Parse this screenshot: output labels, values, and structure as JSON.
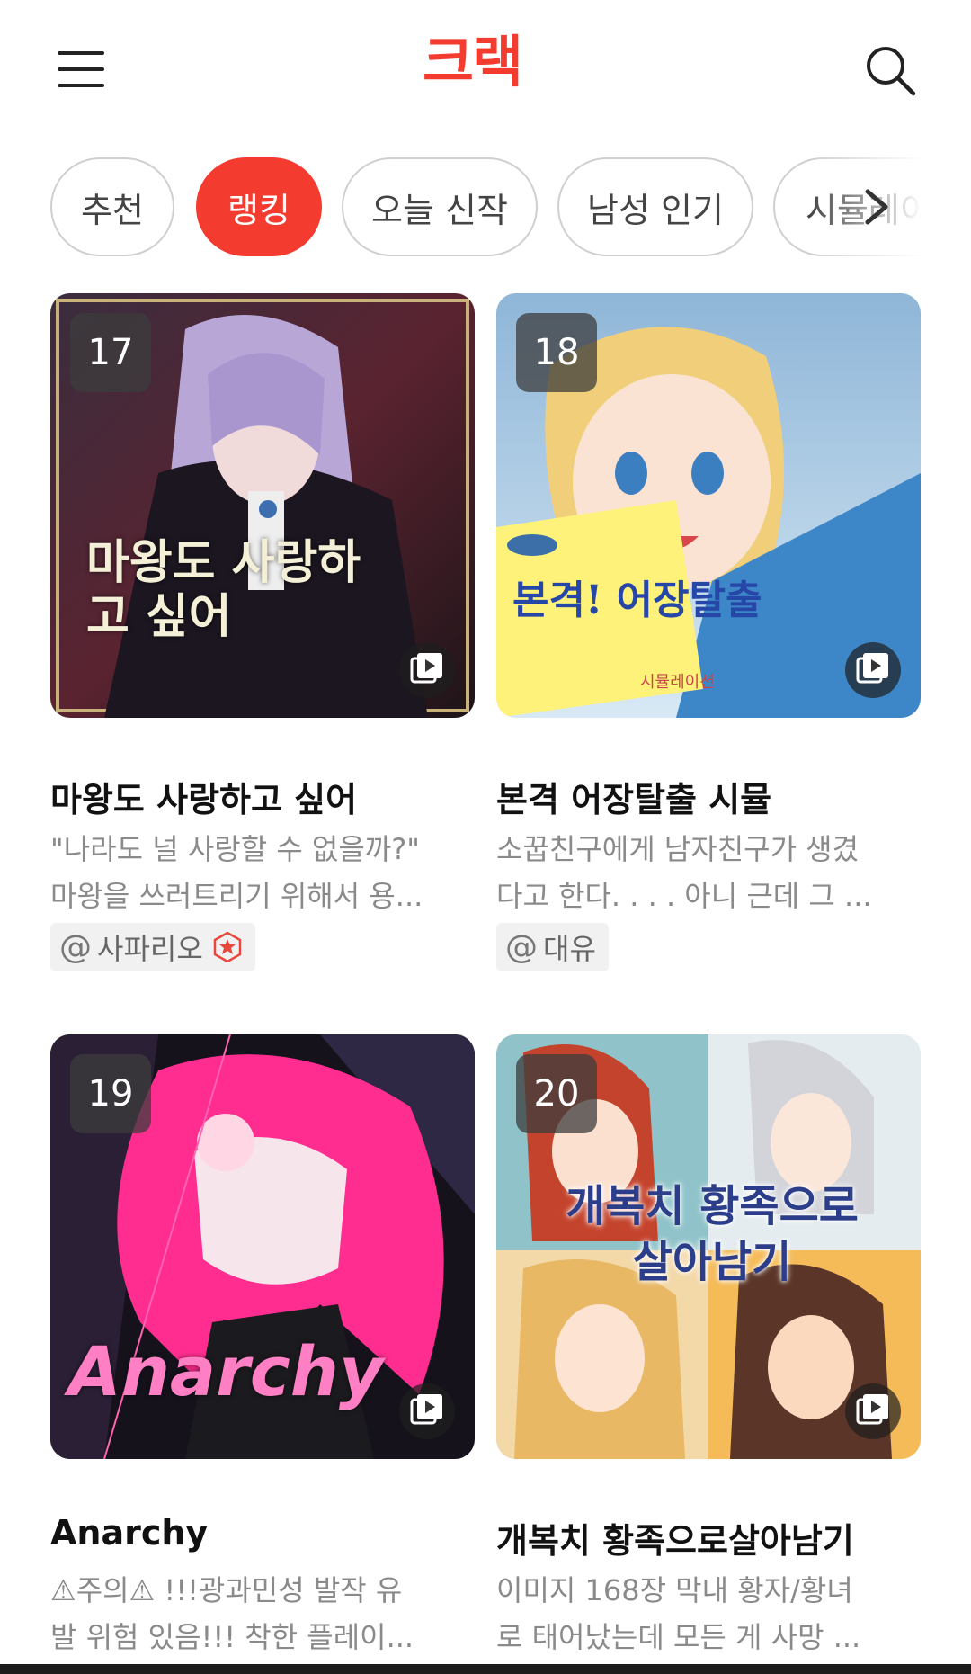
{
  "header": {
    "logo": "크랙",
    "menu_icon": "hamburger-menu-icon",
    "search_icon": "search-icon"
  },
  "accent_color": "#f43b2f",
  "tabs": [
    {
      "label": "추천",
      "active": false
    },
    {
      "label": "랭킹",
      "active": true
    },
    {
      "label": "오늘 신작",
      "active": false
    },
    {
      "label": "남성 인기",
      "active": false
    },
    {
      "label": "시뮬레이",
      "active": false
    }
  ],
  "cards": [
    {
      "rank": "17",
      "cover_text": "마왕도 사랑하고 싶어",
      "title": "마왕도 사랑하고 싶어",
      "desc1": "\"나라도 널 사랑할 수 없을까?\"",
      "desc2": "마왕을 쓰러트리기 위해서 용...",
      "author": "사파리오",
      "author_badge": "verified-star-icon"
    },
    {
      "rank": "18",
      "cover_text": "본격! 어장탈출",
      "cover_sub": "시뮬레이션",
      "title": "본격 어장탈출 시뮬",
      "desc1": "소꿉친구에게 남자친구가 생겼",
      "desc2": "다고 한다. . . . 아니 근데 그 ...",
      "author": "대유"
    },
    {
      "rank": "19",
      "cover_text": "Anarchy",
      "title": "Anarchy",
      "desc1": "⚠주의⚠ !!!광과민성 발작 유",
      "desc2": "발 위험 있음!!! 착한 플레이..."
    },
    {
      "rank": "20",
      "cover_text": "개복치 황족으로 살아남기",
      "title": "개복치 황족으로살아남기",
      "desc1": "이미지 168장 막내 황자/황녀",
      "desc2": "로 태어났는데 모든 게 사망 ..."
    }
  ]
}
